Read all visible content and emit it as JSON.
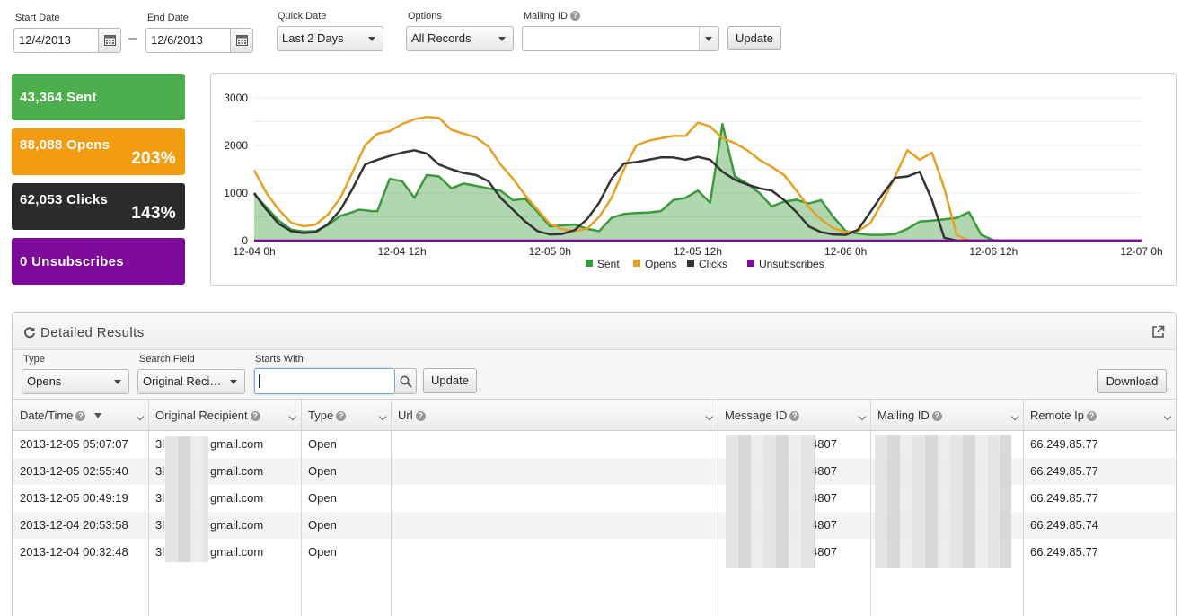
{
  "filters": {
    "start_date_label": "Start Date",
    "start_date_value": "12/4/2013",
    "dash": "–",
    "end_date_label": "End Date",
    "end_date_value": "12/6/2013",
    "quick_date_label": "Quick Date",
    "quick_date_value": "Last 2 Days",
    "options_label": "Options",
    "options_value": "All Records",
    "mailing_id_label": "Mailing ID",
    "mailing_id_value": "",
    "update_label": "Update"
  },
  "stats": [
    {
      "label": "43,364 Sent",
      "percent": "",
      "color": "#4cae4c"
    },
    {
      "label": "88,088 Opens",
      "percent": "203%",
      "color": "#f39c12"
    },
    {
      "label": "62,053 Clicks",
      "percent": "143%",
      "color": "#2b2b2b"
    },
    {
      "label": "0 Unsubscribes",
      "percent": "",
      "color": "#7d0a9a"
    }
  ],
  "chart_data": {
    "type": "line",
    "x_ticks": [
      "12-04 0h",
      "12-04 12h",
      "12-05 0h",
      "12-05 12h",
      "12-06 0h",
      "12-06 12h",
      "12-07 0h"
    ],
    "x_unit": "hours since 12-04 0h",
    "ylim": [
      0,
      3000
    ],
    "y_ticks": [
      0,
      1000,
      2000,
      3000
    ],
    "legend_position": "bottom",
    "series": [
      {
        "name": "Sent",
        "color": "#3b9a3b",
        "fill": true,
        "x": [
          0,
          2,
          4,
          6,
          8,
          10,
          12,
          14,
          16,
          17,
          18,
          19,
          20,
          22,
          24,
          26,
          28,
          30,
          32,
          34,
          36,
          38,
          40,
          42,
          44,
          46,
          48,
          50,
          52,
          54,
          56,
          58,
          60,
          62,
          64,
          66,
          68,
          70,
          72,
          74,
          76,
          78,
          80,
          82,
          84,
          86,
          88,
          90,
          92,
          94,
          96,
          98,
          100,
          102,
          104,
          106,
          108,
          110,
          112,
          114,
          116,
          118,
          120,
          122,
          124,
          126,
          128,
          130,
          132,
          134,
          136,
          138,
          140,
          142,
          144
        ],
        "y": [
          980,
          700,
          420,
          230,
          190,
          200,
          330,
          520,
          600,
          650,
          640,
          620,
          620,
          1300,
          1250,
          900,
          1380,
          1350,
          1100,
          1200,
          1150,
          1100,
          1050,
          850,
          880,
          600,
          300,
          320,
          340,
          250,
          200,
          480,
          560,
          580,
          590,
          620,
          850,
          900,
          1050,
          800,
          2450,
          1350,
          1200,
          1000,
          720,
          820,
          860,
          780,
          850,
          500,
          200,
          150,
          120,
          120,
          140,
          250,
          400,
          420,
          450,
          480,
          600,
          120,
          10,
          0,
          0,
          0,
          0,
          0,
          0,
          0,
          0,
          0,
          0,
          0,
          0
        ]
      },
      {
        "name": "Opens",
        "color": "#e6a024",
        "fill": false,
        "x": [
          0,
          2,
          4,
          6,
          8,
          10,
          12,
          14,
          16,
          18,
          20,
          22,
          24,
          26,
          28,
          30,
          32,
          34,
          36,
          38,
          40,
          42,
          44,
          46,
          48,
          50,
          52,
          54,
          56,
          58,
          60,
          62,
          64,
          66,
          68,
          70,
          72,
          74,
          76,
          78,
          80,
          82,
          84,
          86,
          88,
          90,
          92,
          94,
          96,
          98,
          100,
          102,
          104,
          106,
          108,
          110,
          112,
          114,
          116,
          118,
          120,
          122,
          124,
          126,
          128,
          130,
          132,
          134,
          136,
          138,
          140,
          142,
          144
        ],
        "y": [
          1480,
          1000,
          650,
          380,
          300,
          340,
          550,
          900,
          1450,
          2000,
          2250,
          2300,
          2450,
          2550,
          2600,
          2580,
          2330,
          2250,
          2170,
          1980,
          1600,
          1300,
          950,
          650,
          350,
          240,
          200,
          250,
          500,
          900,
          1500,
          2000,
          2100,
          2150,
          2200,
          2200,
          2480,
          2400,
          2150,
          2050,
          1900,
          1700,
          1550,
          1380,
          1050,
          700,
          450,
          260,
          180,
          200,
          370,
          820,
          1350,
          1900,
          1700,
          1850,
          1100,
          120,
          0,
          0,
          0,
          0,
          0,
          0,
          0,
          0,
          0,
          0,
          0,
          0,
          0,
          0,
          0
        ]
      },
      {
        "name": "Clicks",
        "color": "#333333",
        "fill": false,
        "x": [
          0,
          2,
          4,
          6,
          8,
          10,
          12,
          14,
          16,
          18,
          20,
          22,
          24,
          26,
          28,
          30,
          32,
          34,
          36,
          38,
          40,
          42,
          44,
          46,
          48,
          50,
          52,
          54,
          56,
          58,
          60,
          62,
          64,
          66,
          68,
          70,
          72,
          74,
          76,
          78,
          80,
          82,
          84,
          86,
          88,
          90,
          92,
          94,
          96,
          98,
          100,
          102,
          104,
          106,
          108,
          110,
          112,
          114,
          116,
          118,
          120,
          122,
          124,
          126,
          128,
          130,
          132,
          134,
          136,
          138,
          140,
          142,
          144
        ],
        "y": [
          1000,
          650,
          350,
          200,
          160,
          180,
          350,
          650,
          1100,
          1600,
          1700,
          1780,
          1850,
          1900,
          1830,
          1600,
          1500,
          1420,
          1380,
          1250,
          900,
          650,
          400,
          200,
          130,
          140,
          220,
          450,
          800,
          1300,
          1620,
          1650,
          1700,
          1750,
          1750,
          1700,
          1760,
          1700,
          1450,
          1280,
          1180,
          1100,
          1050,
          850,
          600,
          300,
          180,
          130,
          120,
          230,
          600,
          980,
          1320,
          1350,
          1450,
          850,
          60,
          0,
          0,
          0,
          0,
          0,
          0,
          0,
          0,
          0,
          0,
          0,
          0,
          0,
          0,
          0,
          0
        ]
      },
      {
        "name": "Unsubscribes",
        "color": "#7d0a9a",
        "fill": false,
        "x": [
          0,
          144
        ],
        "y": [
          0,
          0
        ]
      }
    ]
  },
  "detail": {
    "title": "Detailed Results",
    "type_label": "Type",
    "type_value": "Opens",
    "search_field_label": "Search Field",
    "search_field_value": "Original Reci…",
    "starts_with_label": "Starts With",
    "starts_with_value": "",
    "update_label": "Update",
    "download_label": "Download",
    "columns": [
      "Date/Time",
      "Original Recipient",
      "Type",
      "Url",
      "Message ID",
      "Mailing ID",
      "Remote Ip"
    ],
    "rows": [
      {
        "date": "2013-12-05 05:07:07",
        "recipient_a": "3l",
        "recipient_b": "gmail.com",
        "type": "Open",
        "url": "",
        "message_id": "4807",
        "mailing_id": "",
        "ip": "66.249.85.77"
      },
      {
        "date": "2013-12-05 02:55:40",
        "recipient_a": "3l",
        "recipient_b": "gmail.com",
        "type": "Open",
        "url": "",
        "message_id": "4807",
        "mailing_id": "",
        "ip": "66.249.85.77"
      },
      {
        "date": "2013-12-05 00:49:19",
        "recipient_a": "3l",
        "recipient_b": "gmail.com",
        "type": "Open",
        "url": "",
        "message_id": "4807",
        "mailing_id": "",
        "ip": "66.249.85.77"
      },
      {
        "date": "2013-12-04 20:53:58",
        "recipient_a": "3l",
        "recipient_b": "gmail.com",
        "type": "Open",
        "url": "",
        "message_id": "4807",
        "mailing_id": "",
        "ip": "66.249.85.74"
      },
      {
        "date": "2013-12-04 00:32:48",
        "recipient_a": "3l",
        "recipient_b": "gmail.com",
        "type": "Open",
        "url": "",
        "message_id": "4807",
        "mailing_id": "",
        "ip": "66.249.85.77"
      }
    ]
  },
  "icons": {
    "calendar": "calendar-icon",
    "help": "help-icon",
    "refresh": "refresh-icon",
    "external": "external-link-icon",
    "search": "search-icon",
    "sort": "sort-desc-icon"
  }
}
